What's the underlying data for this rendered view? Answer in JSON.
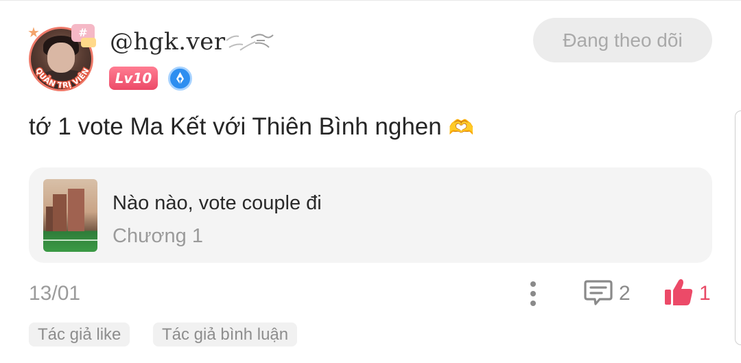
{
  "user": {
    "username": "@hgk.ver",
    "level": "Lv10",
    "avatar_badge_text": "QUẢN TRỊ VIÊN",
    "avatar_sticker": "#"
  },
  "follow_button": {
    "label": "Đang theo dõi"
  },
  "comment": {
    "text": "tớ 1 vote Ma Kết với Thiên Bình nghen",
    "emoji": "🫶"
  },
  "chapter_card": {
    "title": "Nào nào, vote couple đi",
    "subtitle": "Chương 1"
  },
  "footer": {
    "date": "13/01",
    "comment_count": "2",
    "like_count": "1"
  },
  "tags": [
    {
      "label": "Tác giả like"
    },
    {
      "label": "Tác giả bình luận"
    }
  ],
  "icons": {
    "more": "more-vertical-icon",
    "comment": "comment-icon",
    "like": "thumbs-up-icon",
    "verify": "verified-pen-icon"
  },
  "colors": {
    "accent": "#e84a66",
    "level_badge": "#ec4a68",
    "verify_badge": "#2d8ef0",
    "follow_bg": "#ececec",
    "card_bg": "#f4f4f4"
  }
}
